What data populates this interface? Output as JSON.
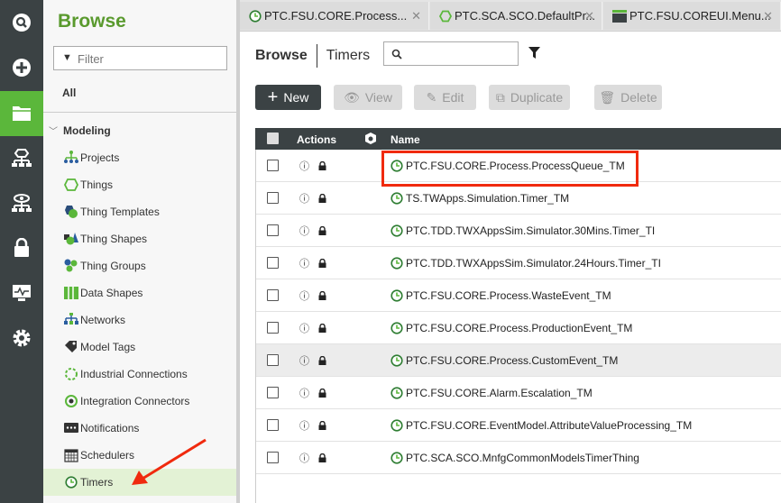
{
  "rail": {
    "icons": [
      "search-icon",
      "plus-icon",
      "folder-icon",
      "hierarchy-icon",
      "monitor-hierarchy-icon",
      "lock-icon",
      "monitor-icon",
      "gear-icon"
    ],
    "active": "folder-icon",
    "accent": "#5bb73b"
  },
  "sidebar": {
    "title": "Browse",
    "filter_placeholder": "Filter",
    "all": "All",
    "section": "Modeling",
    "items": [
      {
        "label": "Projects"
      },
      {
        "label": "Things"
      },
      {
        "label": "Thing Templates"
      },
      {
        "label": "Thing Shapes"
      },
      {
        "label": "Thing Groups"
      },
      {
        "label": "Data Shapes"
      },
      {
        "label": "Networks"
      },
      {
        "label": "Model Tags"
      },
      {
        "label": "Industrial Connections"
      },
      {
        "label": "Integration Connectors"
      },
      {
        "label": "Notifications"
      },
      {
        "label": "Schedulers"
      },
      {
        "label": "Timers"
      }
    ],
    "selected": "Timers"
  },
  "tabs": [
    {
      "label": "PTC.FSU.CORE.Process...",
      "icon": "timer-icon"
    },
    {
      "label": "PTC.SCA.SCO.DefaultPr...",
      "icon": "thing-icon"
    },
    {
      "label": "PTC.FSU.COREUI.Menu...",
      "icon": "mashup-icon"
    }
  ],
  "breadcrumb": {
    "root": "Browse",
    "current": "Timers"
  },
  "search": {
    "placeholder": "",
    "value": ""
  },
  "toolbar": {
    "new": "New",
    "view": "View",
    "edit": "Edit",
    "duplicate": "Duplicate",
    "delete": "Delete"
  },
  "table": {
    "headers": {
      "actions": "Actions",
      "name": "Name"
    },
    "rows": [
      {
        "name": "PTC.FSU.CORE.Process.ProcessQueue_TM"
      },
      {
        "name": "TS.TWApps.Simulation.Timer_TM"
      },
      {
        "name": "PTC.TDD.TWXAppsSim.Simulator.30Mins.Timer_TI"
      },
      {
        "name": "PTC.TDD.TWXAppsSim.Simulator.24Hours.Timer_TI"
      },
      {
        "name": "PTC.FSU.CORE.Process.WasteEvent_TM"
      },
      {
        "name": "PTC.FSU.CORE.Process.ProductionEvent_TM"
      },
      {
        "name": "PTC.FSU.CORE.Process.CustomEvent_TM"
      },
      {
        "name": "PTC.FSU.CORE.Alarm.Escalation_TM"
      },
      {
        "name": "PTC.FSU.CORE.EventModel.AttributeValueProcessing_TM"
      },
      {
        "name": "PTC.SCA.SCO.MnfgCommonModelsTimerThing"
      }
    ],
    "hovered_row": 7
  },
  "annotation": {
    "highlight_color": "#f02a0e"
  }
}
